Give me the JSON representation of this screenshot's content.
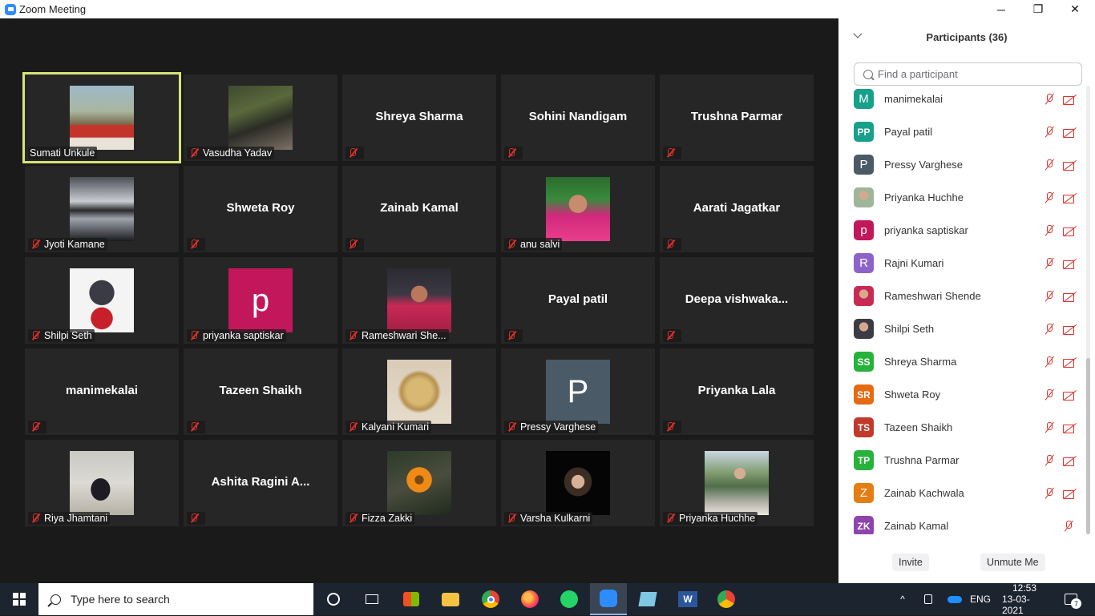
{
  "window": {
    "title": "Zoom Meeting",
    "controls": {
      "minimize": "─",
      "maximize": "❐",
      "close": "✕"
    }
  },
  "gallery": [
    {
      "name": "Sumati Unkule",
      "type": "photo",
      "photo": "ph-sumati",
      "muted": false,
      "active": true
    },
    {
      "name": "Vasudha Yadav",
      "type": "photo",
      "photo": "ph-vasudha",
      "muted": true
    },
    {
      "name": "Shreya Sharma",
      "type": "name",
      "muted": true
    },
    {
      "name": "Sohini Nandigam",
      "type": "name",
      "muted": true
    },
    {
      "name": "Trushna Parmar",
      "type": "name",
      "muted": true
    },
    {
      "name": "Jyoti Kamane",
      "type": "photo",
      "photo": "ph-jyoti",
      "muted": true
    },
    {
      "name": "Shweta Roy",
      "type": "name",
      "muted": true
    },
    {
      "name": "Zainab Kamal",
      "type": "name",
      "muted": true
    },
    {
      "name": "anu salvi",
      "type": "photo",
      "photo": "ph-anu",
      "muted": true
    },
    {
      "name": "Aarati Jagatkar",
      "type": "name",
      "muted": true
    },
    {
      "name": "Shilpi Seth",
      "type": "photo",
      "photo": "ph-shilpi",
      "muted": true
    },
    {
      "name": "priyanka saptiskar",
      "type": "photo",
      "photo": "ph-p-magenta",
      "letter": "p",
      "muted": true
    },
    {
      "name": "Rameshwari She...",
      "type": "photo",
      "photo": "ph-rameshwari",
      "muted": true
    },
    {
      "name": "Payal patil",
      "type": "name",
      "muted": true
    },
    {
      "name": "Deepa  vishwaka...",
      "type": "name",
      "muted": true
    },
    {
      "name": "manimekalai",
      "type": "name",
      "muted": true
    },
    {
      "name": "Tazeen Shaikh",
      "type": "name",
      "muted": true
    },
    {
      "name": "Kalyani Kumari",
      "type": "photo",
      "photo": "ph-kalyani",
      "muted": true
    },
    {
      "name": "Pressy Varghese",
      "type": "photo",
      "photo": "ph-p-slate",
      "letter": "P",
      "muted": true
    },
    {
      "name": "Priyanka Lala",
      "type": "name",
      "muted": true
    },
    {
      "name": "Riya Jhamtani",
      "type": "photo",
      "photo": "ph-riya",
      "muted": true
    },
    {
      "name": "Ashita Ragini A...",
      "type": "name",
      "muted": true
    },
    {
      "name": "Fizza Zakki",
      "type": "photo",
      "photo": "ph-fizza",
      "muted": true
    },
    {
      "name": "Varsha Kulkarni",
      "type": "photo",
      "photo": "ph-varsha",
      "muted": true
    },
    {
      "name": "Priyanka Huchhe",
      "type": "photo",
      "photo": "ph-priyanka-h",
      "muted": true
    }
  ],
  "panel": {
    "title": "Participants (36)",
    "search_placeholder": "Find a participant",
    "participants": [
      {
        "name": "manimekalai",
        "initials": "M",
        "color": "#17a08a",
        "big": true,
        "video_off": true
      },
      {
        "name": "Payal patil",
        "initials": "PP",
        "color": "#17a08a",
        "video_off": true
      },
      {
        "name": "Pressy Varghese",
        "initials": "P",
        "color": "#4a5a66",
        "big": true,
        "video_off": true
      },
      {
        "name": "Priyanka Huchhe",
        "initials": "",
        "color": "#9fb59a",
        "photo": true,
        "video_off": true
      },
      {
        "name": "priyanka saptiskar",
        "initials": "p",
        "color": "#c2185b",
        "big": true,
        "video_off": true
      },
      {
        "name": "Rajni Kumari",
        "initials": "R",
        "color": "#8e63c9",
        "big": true,
        "video_off": true
      },
      {
        "name": "Rameshwari Shende",
        "initials": "",
        "color": "#c72a55",
        "photo": true,
        "video_off": true
      },
      {
        "name": "Shilpi Seth",
        "initials": "",
        "color": "#3b3b46",
        "photo": true,
        "video_off": true
      },
      {
        "name": "Shreya Sharma",
        "initials": "SS",
        "color": "#27b33b",
        "video_off": true
      },
      {
        "name": "Shweta Roy",
        "initials": "SR",
        "color": "#e46b12",
        "video_off": true
      },
      {
        "name": "Tazeen Shaikh",
        "initials": "TS",
        "color": "#c0392b",
        "video_off": true
      },
      {
        "name": "Trushna Parmar",
        "initials": "TP",
        "color": "#27b33b",
        "video_off": true
      },
      {
        "name": "Zainab Kachwala",
        "initials": "Z",
        "color": "#e47e12",
        "big": true,
        "video_off": true
      },
      {
        "name": "Zainab Kamal",
        "initials": "ZK",
        "color": "#8e44ad",
        "video_off": false
      }
    ],
    "invite_label": "Invite",
    "unmute_label": "Unmute Me"
  },
  "taskbar": {
    "search_placeholder": "Type here to search",
    "lang": "ENG",
    "time": "12:53",
    "date": "13-03-2021",
    "notifications": "7"
  }
}
